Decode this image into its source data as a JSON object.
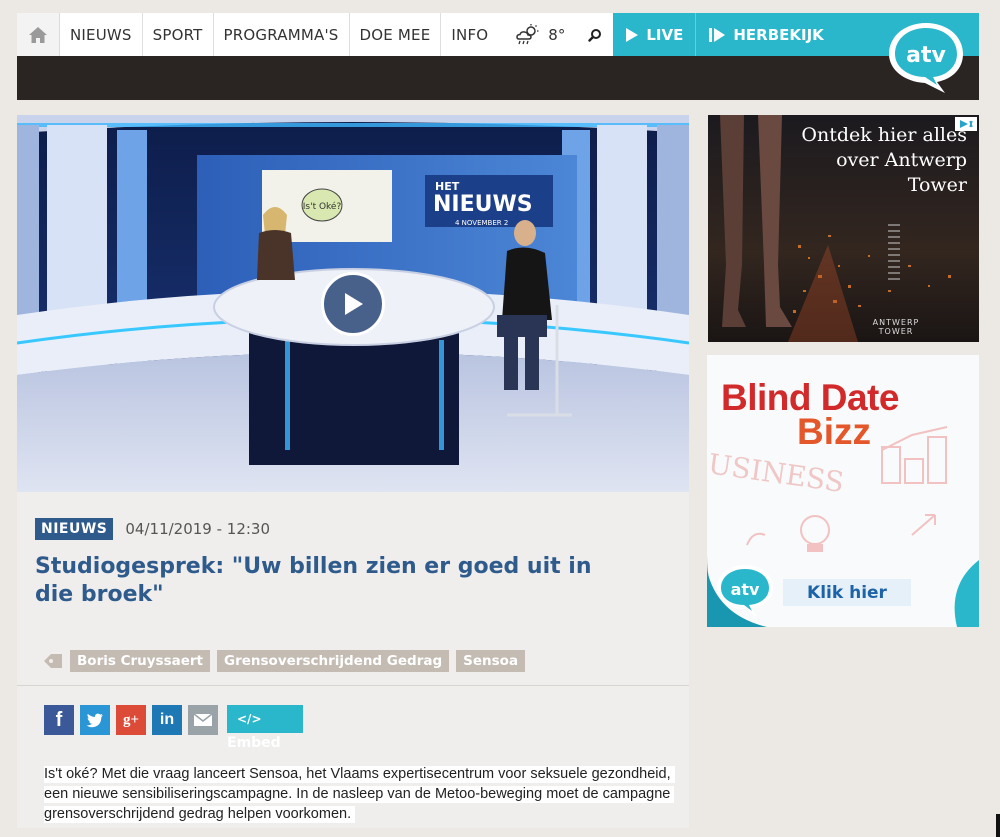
{
  "nav": {
    "home_icon": "home-icon",
    "items": [
      "NIEUWS",
      "SPORT",
      "PROGRAMMA'S",
      "DOE MEE",
      "INFO"
    ],
    "weather": {
      "icon": "weather-cloud-sun-rain-icon",
      "temp": "8°"
    },
    "search_icon": "search-icon",
    "live": "LIVE",
    "replay": "HERBEKIJK",
    "logo_text": "atv"
  },
  "video": {
    "play_icon": "play-icon",
    "studio_sign": {
      "line1": "HET",
      "line2": "NIEUWS",
      "date": "4 NOVEMBER 2"
    },
    "studio_poster": "Is't Oké?"
  },
  "article": {
    "category": "NIEUWS",
    "date": "04/11/2019 - 12:30",
    "title": "Studiogesprek: \"Uw billen zien er goed uit in die broek\"",
    "tags": [
      "Boris Cruyssaert",
      "Grensoverschrijdend Gedrag",
      "Sensoa"
    ],
    "share": {
      "facebook": "f",
      "twitter": "twitter-bird-icon",
      "googleplus": "g+",
      "linkedin": "in",
      "email": "mail-icon",
      "embed_symbol": "</>",
      "embed_label": "Embed"
    },
    "intro": "Is't oké? Met die vraag lanceert Sensoa, het Vlaams expertisecentrum voor seksuele gezondheid, een nieuwe sensibiliseringscampagne. In de nasleep van de Metoo-beweging moet de campagne grensoverschrijdend gedrag helpen voorkomen."
  },
  "ads": {
    "ad1": {
      "headline": "Ontdek hier alles over Antwerp Tower",
      "brand": "ANTWERP TOWER"
    },
    "ad2": {
      "title_line1": "Blind Date",
      "title_line2": "Bizz",
      "bg_word": "USINESS",
      "logo": "atv",
      "cta": "Klik hier"
    }
  },
  "colors": {
    "accent": "#2ab7cc",
    "brand_blue": "#2f5b8c",
    "tag": "#c4bcb3",
    "dark_bar": "#2a2422"
  }
}
